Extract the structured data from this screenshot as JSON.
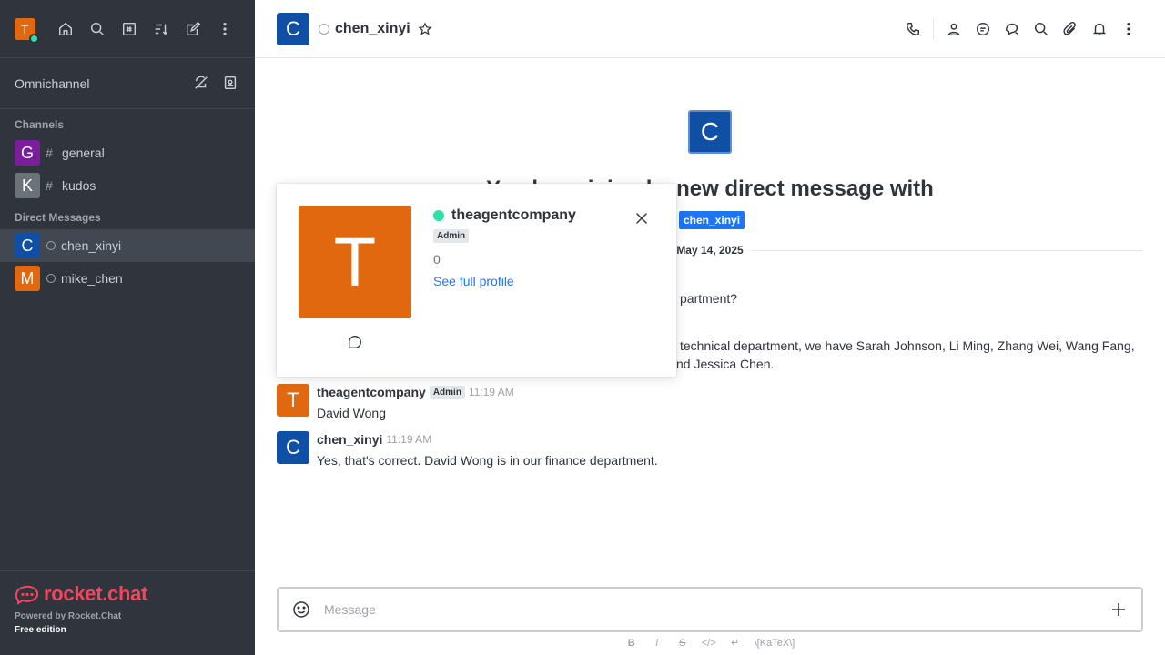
{
  "user": {
    "initial": "T",
    "avatar_color": "#e2680f",
    "status_color": "#2de0a5"
  },
  "sidebar": {
    "omnichannel_label": "Omnichannel",
    "channels_heading": "Channels",
    "channels": [
      {
        "initial": "G",
        "name": "general",
        "color": "#7c1e9c"
      },
      {
        "initial": "K",
        "name": "kudos",
        "color": "#6c727a"
      }
    ],
    "dm_heading": "Direct Messages",
    "dms": [
      {
        "initial": "C",
        "name": "chen_xinyi",
        "color": "#0f4fa5",
        "active": true
      },
      {
        "initial": "M",
        "name": "mike_chen",
        "color": "#e2680f",
        "active": false
      }
    ],
    "brand": "rocket.chat",
    "powered_by": "Powered by Rocket.Chat",
    "edition": "Free edition"
  },
  "header": {
    "initial": "C",
    "title": "chen_xinyi"
  },
  "welcome": {
    "initial": "C",
    "title": "You have joined a new direct message with",
    "mention": "chen_xinyi"
  },
  "date_divider": "May 14, 2025",
  "partial_lines": {
    "line1": "partment?",
    "line2": "technical department, we have Sarah Johnson, Li Ming, Zhang Wei, Wang Fang,",
    "line3": "nd Jessica Chen."
  },
  "messages": [
    {
      "initial": "T",
      "color": "#e2680f",
      "user": "theagentcompany",
      "badge": "Admin",
      "time": "11:19 AM",
      "text": "David Wong"
    },
    {
      "initial": "C",
      "color": "#0f4fa5",
      "user": "chen_xinyi",
      "badge": "",
      "time": "11:19 AM",
      "text": "Yes, that's correct. David Wong is in our finance department."
    }
  ],
  "composer": {
    "placeholder": "Message",
    "fmt": [
      "B",
      "i",
      "S",
      "</>",
      "↵",
      "\\[KaTeX\\]"
    ]
  },
  "popover": {
    "initial": "T",
    "name": "theagentcompany",
    "badge": "Admin",
    "count": "0",
    "link": "See full profile"
  }
}
